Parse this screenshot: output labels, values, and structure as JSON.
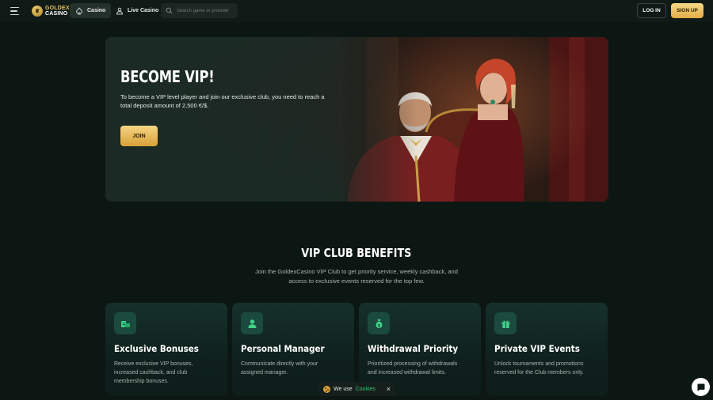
{
  "header": {
    "logo_line1": "GOLDEX",
    "logo_line2": "CASINO",
    "tabs": [
      {
        "label": "Casino",
        "icon": "spade-icon",
        "active": true
      },
      {
        "label": "Live Casino",
        "icon": "dealer-icon",
        "active": false
      }
    ],
    "search_placeholder": "Search game or provider",
    "login_label": "LOG IN",
    "signup_label": "SIGN UP"
  },
  "hero": {
    "title": "BECOME VIP!",
    "text": "To become a VIP level player and join our exclusive club, you need to reach a total deposit amount of 2,500 €/$.",
    "join_label": "JOIN"
  },
  "benefits": {
    "title": "VIP CLUB BENEFITS",
    "subtitle": "Join the GoldexCasino VIP Club to get priority service, weekly cashback, and access to exclusive events reserved for the top few.",
    "cards": [
      {
        "icon": "coins-icon",
        "title": "Exclusive Bonuses",
        "text": "Receive exclusive VIP bonuses, increased cashback, and club membership bonuses."
      },
      {
        "icon": "user-icon",
        "title": "Personal Manager",
        "text": "Communicate directly with your assigned manager."
      },
      {
        "icon": "money-bag-icon",
        "title": "Withdrawal Priority",
        "text": "Prioritized processing of withdrawals and increased withdrawal limits."
      },
      {
        "icon": "gift-icon",
        "title": "Private VIP Events",
        "text": "Unlock tournaments and promotions reserved for the Club members only."
      }
    ]
  },
  "cookie": {
    "prefix": "We use",
    "link": "Cookies",
    "close": "×"
  },
  "colors": {
    "background": "#0c1714",
    "gold": "#e2ad44",
    "accent_green": "#34c26a"
  }
}
